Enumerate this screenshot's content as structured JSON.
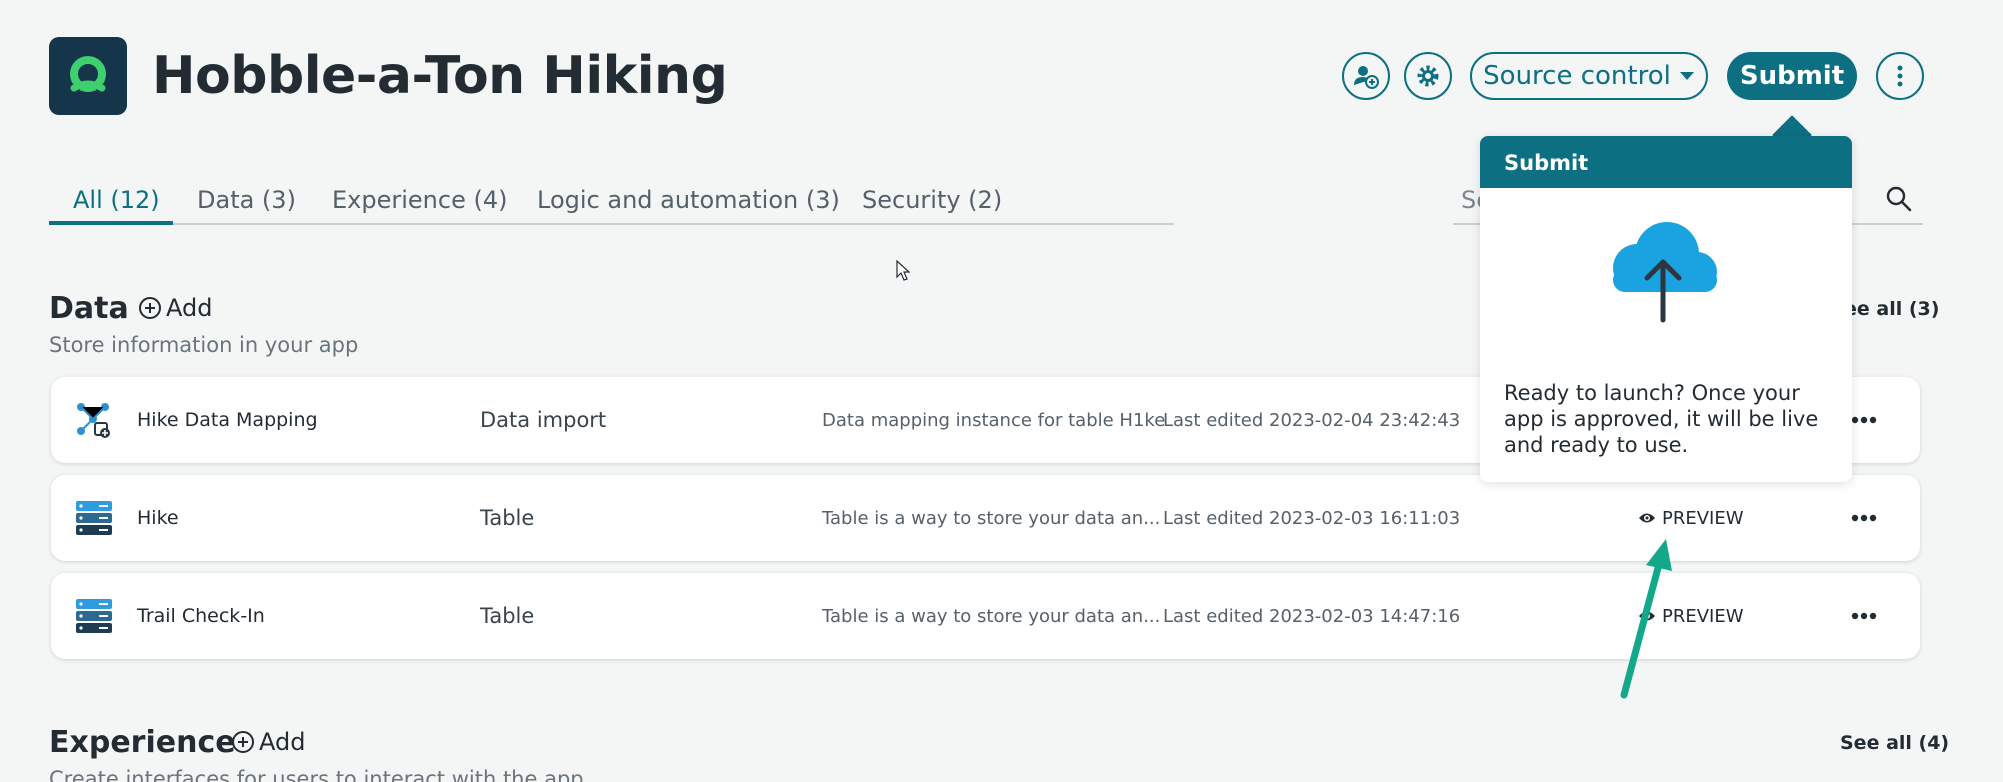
{
  "app": {
    "title": "Hobble-a-Ton Hiking"
  },
  "header": {
    "source_control_label": "Source control",
    "submit_label": "Submit",
    "icons": [
      "add-user-icon",
      "gear-icon",
      "vertical-dots-icon"
    ]
  },
  "tabs": [
    {
      "label": "All (12)",
      "active": true
    },
    {
      "label": "Data (3)",
      "active": false
    },
    {
      "label": "Experience (4)",
      "active": false
    },
    {
      "label": "Logic and automation (3)",
      "active": false
    },
    {
      "label": "Security (2)",
      "active": false
    }
  ],
  "search": {
    "placeholder": "Se"
  },
  "data_section": {
    "title": "Data",
    "add_label": "Add",
    "subtitle": "Store information in your app",
    "see_all": "ee all (3)",
    "rows": [
      {
        "name": "Hike Data Mapping",
        "type": "Data import",
        "description": "Data mapping instance for table H1ke",
        "edited": "Last edited 2023-02-04 23:42:43",
        "preview": "",
        "icon": "data-mapping-icon"
      },
      {
        "name": "Hike",
        "type": "Table",
        "description": "Table is a way to store your data an...",
        "edited": "Last edited 2023-02-03 16:11:03",
        "preview": "PREVIEW",
        "icon": "table-icon"
      },
      {
        "name": "Trail Check-In",
        "type": "Table",
        "description": "Table is a way to store your data an...",
        "edited": "Last edited 2023-02-03 14:47:16",
        "preview": "PREVIEW",
        "icon": "table-icon"
      }
    ]
  },
  "experience_section": {
    "title": "Experience",
    "add_label": "Add",
    "subtitle": "Create interfaces for users to interact with the app",
    "see_all": "See all (4)"
  },
  "popover": {
    "title": "Submit",
    "body": "Ready to launch? Once your app is approved, it will be live and ready to use.",
    "icon": "cloud-upload-icon"
  },
  "colors": {
    "accent": "#0d6f82",
    "logo_bg": "#14354a",
    "logo_ring": "#3ecf6e",
    "cloud": "#1aa3e0",
    "annotation_arrow": "#14a88a",
    "background": "#f4f6f6"
  }
}
